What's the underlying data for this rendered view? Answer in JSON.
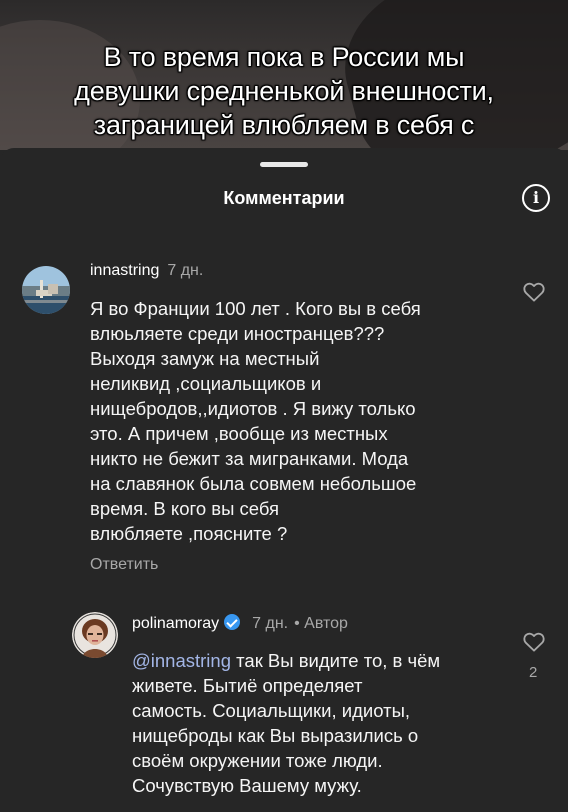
{
  "video": {
    "caption_lines": [
      "В то время пока в России мы",
      "девушки средненькой внешности,",
      "заграницей влюбляем в себя с"
    ]
  },
  "sheet": {
    "title": "Комментарии",
    "info_icon": "info-icon",
    "info_glyph": "i"
  },
  "comments": [
    {
      "username": "innastring",
      "time": "7 дн.",
      "body_lines": [
        "Я во Франции 100 лет . Кого вы в себя",
        "влюьляете среди иностранцев???",
        "Выходя  замуж на местный",
        "неликвид ,социальщиков и",
        "нищебродов,,идиотов . Я вижу только",
        "это. А причем ,вообще из местных",
        "никто не бежит за мигранками. Мода",
        "на славянок была совмем небольшое",
        "время. В кого вы себя",
        "влюбляете ,поясните ?"
      ],
      "reply_label": "Ответить",
      "like_icon": "heart-outline-icon"
    },
    {
      "username": "polinamoray",
      "verified": true,
      "time": "7 дн.",
      "author_label": "• Автор",
      "mention": "@innastring",
      "body_first_rest": " так Вы видите то, в чём",
      "body_lines": [
        "живете. Бытиё определяет",
        "самость. Социальщики, идиоты,",
        "нищеброды как Вы выразились о",
        "своём окружении тоже люди.",
        "Сочувствую Вашему мужу."
      ],
      "like_count": "2",
      "like_icon": "heart-outline-icon"
    }
  ]
}
